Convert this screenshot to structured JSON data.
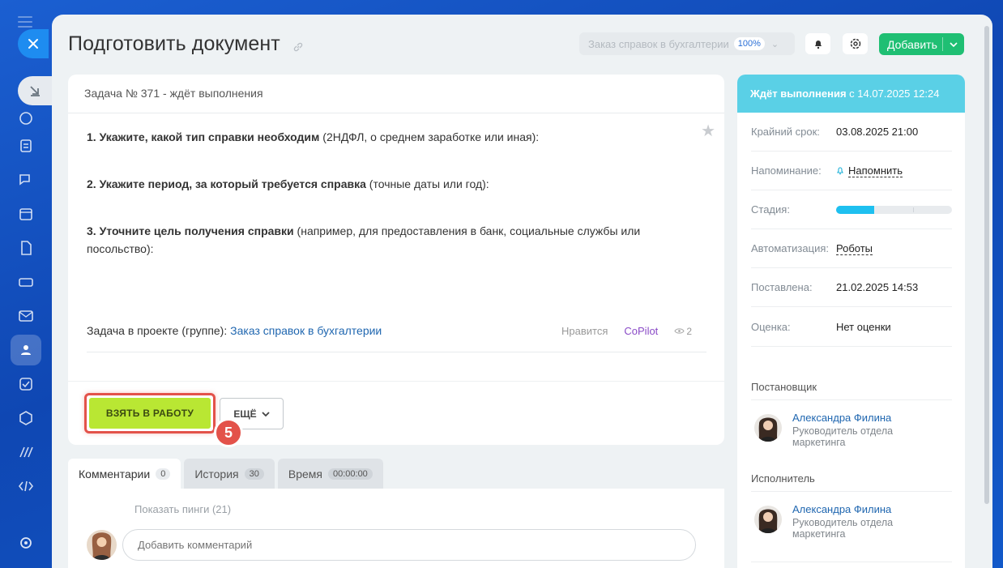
{
  "task": {
    "title": "Подготовить документ",
    "header": "Задача № 371 - ждёт выполнения",
    "description": [
      {
        "bold": "1. Укажите, какой тип справки необходим",
        "rest": " (2НДФЛ, о среднем заработке или иная):"
      },
      {
        "bold": "2. Укажите период, за который требуется справка",
        "rest": " (точные даты или год):"
      },
      {
        "bold": "3. Уточните цель получения справки",
        "rest": " (например, для предоставления в банк, социальные службы или посольство):"
      }
    ],
    "project_label": "Задача в проекте (группе):",
    "project_link": "Заказ справок в бухгалтерии",
    "like_label": "Нравится",
    "author": "CoPilot",
    "views": "2"
  },
  "toolbar": {
    "project_select": "Заказ справок в бухгалтерии",
    "project_percent": "100%",
    "add_label": "Добавить"
  },
  "actions": {
    "take_label": "ВЗЯТЬ В РАБОТУ",
    "more_label": "ЕЩЁ",
    "step_badge": "5"
  },
  "tabs": [
    {
      "label": "Комментарии",
      "count": "0"
    },
    {
      "label": "История",
      "count": "30"
    },
    {
      "label": "Время",
      "count": "00:00:00"
    }
  ],
  "comments": {
    "pings": "Показать пинги (21)",
    "placeholder": "Добавить комментарий"
  },
  "sidebar": {
    "status_bold": "Ждёт выполнения",
    "status_rest": " с 14.07.2025 12:24",
    "deadline_label": "Крайний срок:",
    "deadline_value": "03.08.2025 21:00",
    "reminder_label": "Напоминание:",
    "reminder_value": "Напомнить",
    "stage_label": "Стадия:",
    "stage_progress": 0.33,
    "automation_label": "Автоматизация:",
    "automation_value": "Роботы",
    "created_label": "Поставлена:",
    "created_value": "21.02.2025 14:53",
    "rating_label": "Оценка:",
    "rating_value": "Нет оценки",
    "creator_title": "Постановщик",
    "creator_name": "Александра Филина",
    "creator_role": "Руководитель отдела маркетинга",
    "assignee_title": "Исполнитель",
    "assignee_name": "Александра Филина",
    "assignee_role": "Руководитель отдела маркетинга"
  },
  "colors": {
    "accent_green": "#1fbf73",
    "take_button": "#b9e733",
    "status_cyan": "#5ad0e6",
    "highlight_red": "#e3524a"
  }
}
